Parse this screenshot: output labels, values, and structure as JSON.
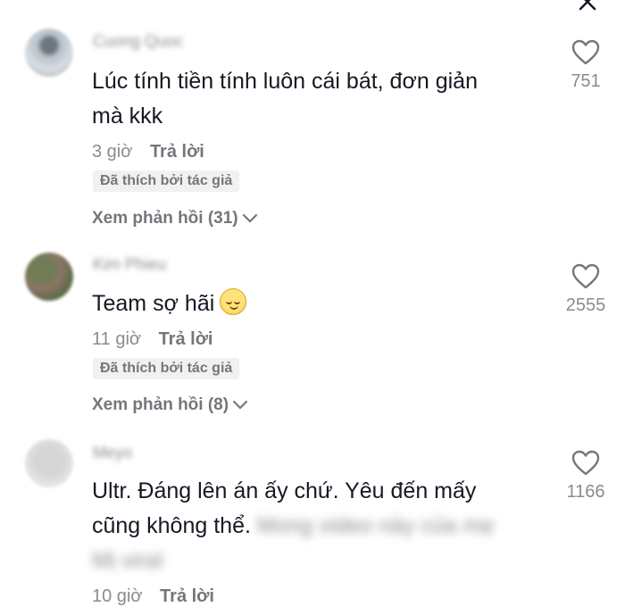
{
  "comments": [
    {
      "username": "Cuong Quoc",
      "text": "Lúc tính tiền tính luôn cái bát, đơn giản",
      "text_line2": "mà kkk",
      "time": "3 giờ",
      "reply_label": "Trả lời",
      "badge": "Đã thích bởi tác giả",
      "view_replies": "Xem phản hồi (31)",
      "likes": "751"
    },
    {
      "username": "Kim Phieu",
      "text": "Team sợ hãi",
      "time": "11 giờ",
      "reply_label": "Trả lời",
      "badge": "Đã thích bởi tác giả",
      "view_replies": "Xem phản hồi (8)",
      "likes": "2555"
    },
    {
      "username": "Meyo",
      "text": "Ultr. Đáng lên án ấy chứ. Yêu đến mấy",
      "text_line2": "cũng không thể.",
      "blurred_tail": "Mong video này của mẹ",
      "blurred_line3": "Mị viral",
      "time": "10 giờ",
      "reply_label": "Trả lời",
      "likes": "1166"
    }
  ],
  "icons": {
    "close": "close-icon",
    "heart": "heart-icon",
    "chevron": "chevron-down-icon",
    "emoji": "relieved-face-emoji"
  },
  "colors": {
    "text": "#161823",
    "muted": "#8a8b91",
    "badge_bg": "#f1f1f2"
  }
}
